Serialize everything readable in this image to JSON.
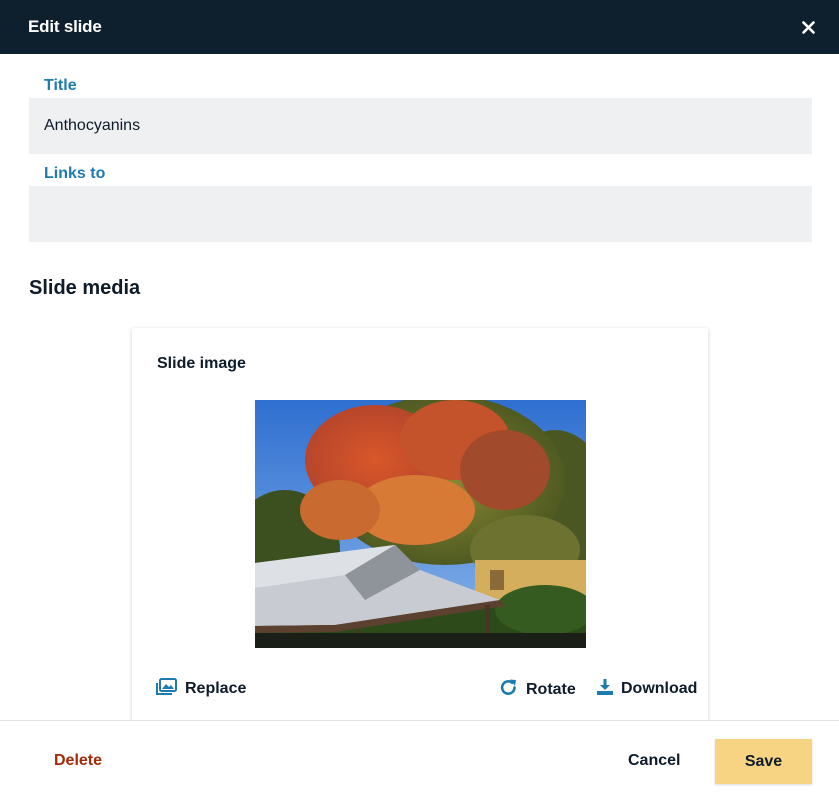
{
  "dialog": {
    "title": "Edit slide",
    "close_icon": "close-icon"
  },
  "form": {
    "title_label": "Title",
    "title_value": "Anthocyanins",
    "links_label": "Links to",
    "links_value": ""
  },
  "media": {
    "section_title": "Slide media",
    "card_title": "Slide image",
    "image_description": "autumn tree with red and orange leaves behind a carport roof",
    "actions": {
      "replace": "Replace",
      "rotate": "Rotate",
      "download": "Download"
    }
  },
  "footer": {
    "delete": "Delete",
    "cancel": "Cancel",
    "save": "Save"
  },
  "colors": {
    "header_bg": "#0e1f2e",
    "label_blue": "#1e7bb0",
    "delete_red": "#a32a0a",
    "save_yellow": "#f7d483",
    "input_bg": "#eff0f2"
  }
}
